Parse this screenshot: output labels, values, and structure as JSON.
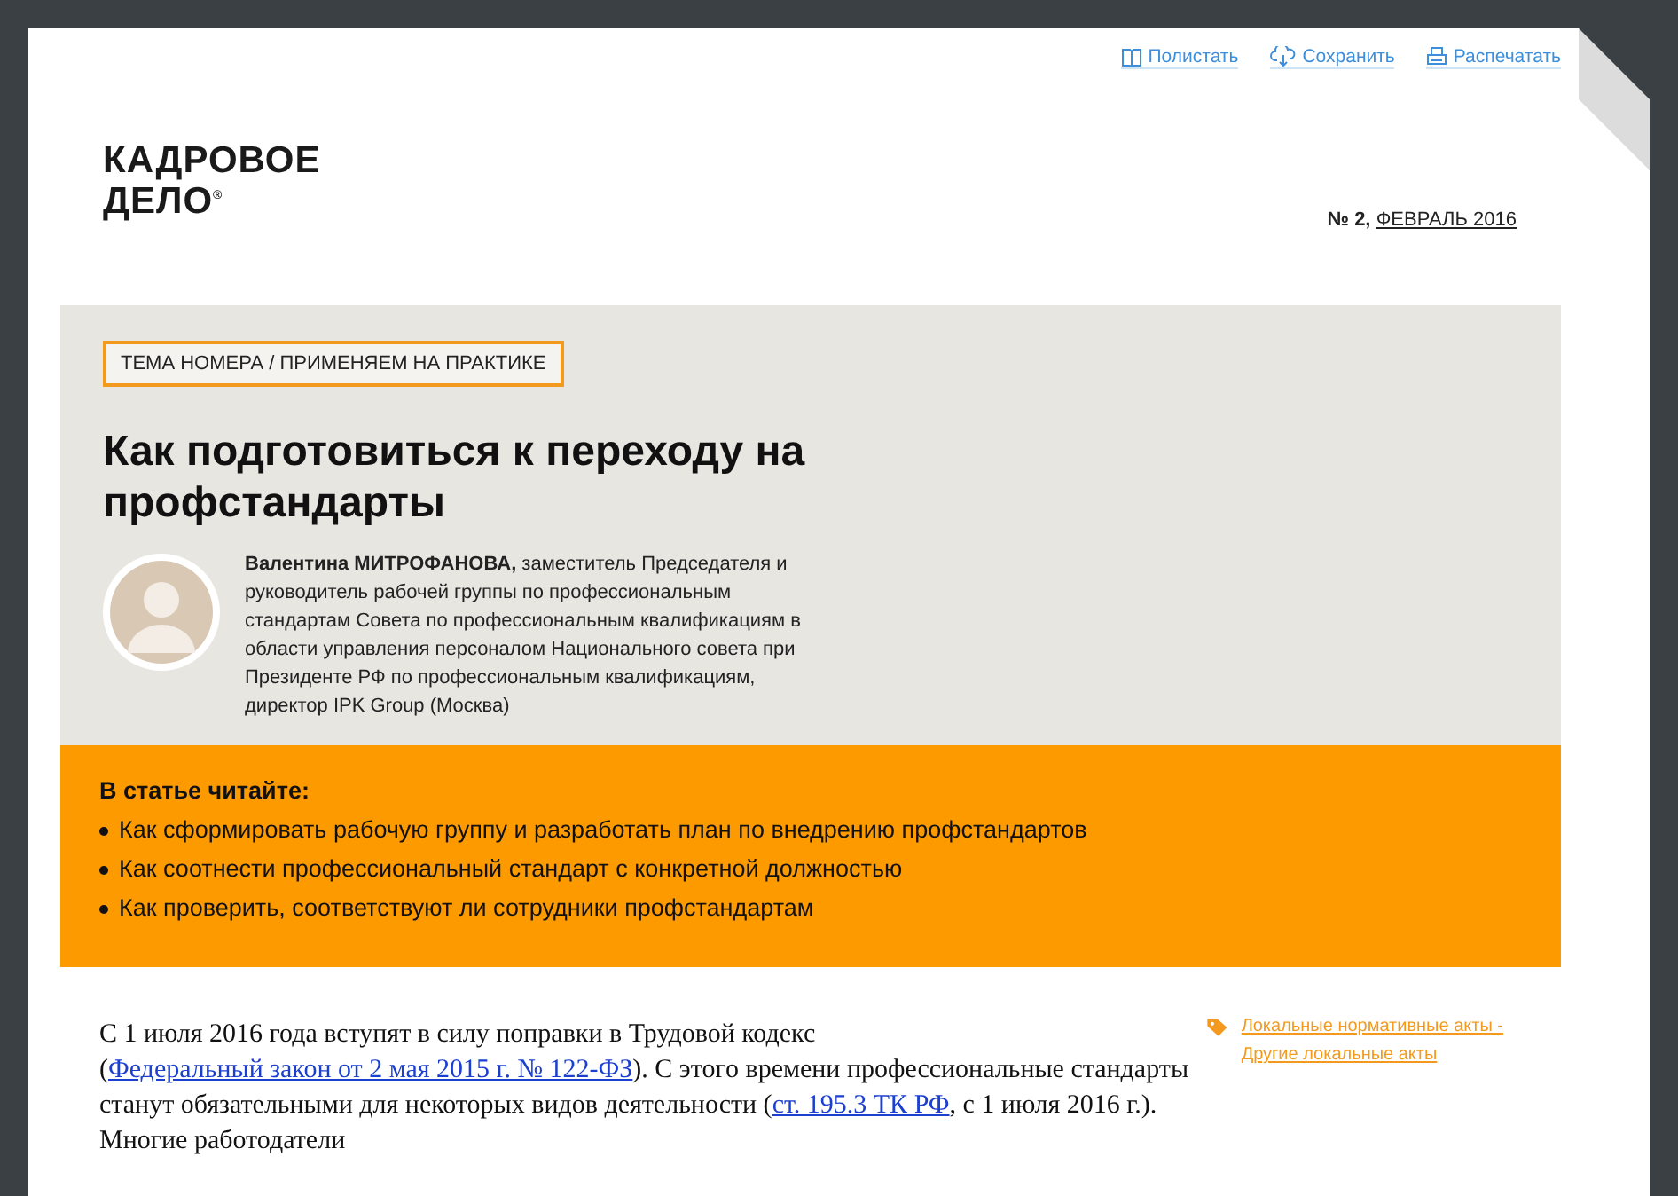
{
  "toolbar": [
    {
      "kind": "book",
      "label": "Полистать"
    },
    {
      "kind": "cloud",
      "label": "Сохранить"
    },
    {
      "kind": "print",
      "label": "Распечатать"
    }
  ],
  "logo": {
    "line_1": "КАДРОВОЕ",
    "line_2": "ДЕЛО",
    "mark": "®"
  },
  "issue": {
    "number": "№ 2,",
    "date": "ФЕВРАЛЬ 2016"
  },
  "rubric": "ТЕМА НОМЕРА / ПРИМЕНЯЕМ НА ПРАКТИКЕ",
  "title": "Как подготовиться к переходу на профстандарты",
  "author": {
    "bio": "**Валентина МИТРОФАНОВА,** заместитель Председателя и руководитель рабочей группы по профессиональным стандартам Совета по профессиональным квалификациям в области управления персоналом Национального совета при Президенте РФ по профессиональным квалификациям, директор IPK Group (Москва)"
  },
  "summary": {
    "heading": "В статье читайте:",
    "items": [
      "Как сформировать рабочую группу и разработать план по внедрению профстандартов",
      "Как соотнести профессиональный стандарт с конкретной должностью",
      "Как проверить, соответствуют ли сотрудники профстандартам"
    ]
  },
  "body": [
    {
      "kind": "text",
      "text": "С 1 июля 2016 года вступят в силу поправки в Трудовой кодекс ("
    },
    {
      "kind": "link",
      "text": "Федеральный закон от 2 мая 2015 г. № 122-ФЗ"
    },
    {
      "kind": "text",
      "text": "). С этого времени профессиональные стандарты станут обязательными для некоторых видов деятельности ("
    },
    {
      "kind": "link",
      "text": "ст. 195.3 ТК РФ"
    },
    {
      "kind": "text",
      "text": ", с 1 июля 2016 г.). Многие работодатели"
    }
  ],
  "tag": {
    "text": "Локальные нормативные акты - Другие локальные акты"
  }
}
